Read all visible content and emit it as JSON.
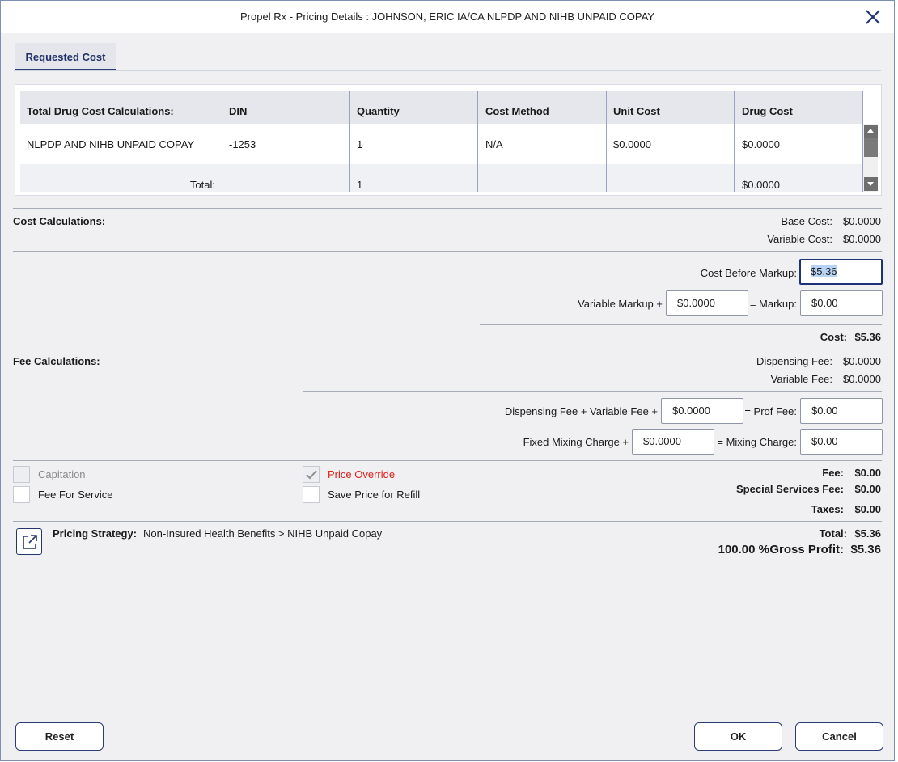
{
  "window": {
    "title": "Propel Rx - Pricing Details :  JOHNSON, ERIC IA/CA  NLPDP AND NIHB UNPAID COPAY"
  },
  "tabs": [
    {
      "label": "Requested Cost",
      "active": true
    }
  ],
  "drug_cost_grid": {
    "columns": [
      "Total Drug Cost Calculations:",
      "DIN",
      "Quantity",
      "Cost Method",
      "Unit Cost",
      "Drug Cost"
    ],
    "rows": [
      {
        "name": "NLPDP AND NIHB UNPAID COPAY",
        "din": "-1253",
        "quantity": "1",
        "cost_method": "N/A",
        "unit_cost": "$0.0000",
        "drug_cost": "$0.0000"
      }
    ],
    "total": {
      "label": "Total:",
      "quantity": "1",
      "drug_cost": "$0.0000"
    }
  },
  "cost_calculations": {
    "section_label": "Cost Calculations:",
    "base_cost_label": "Base Cost:",
    "base_cost_value": "$0.0000",
    "variable_cost_label": "Variable Cost:",
    "variable_cost_value": "$0.0000",
    "cost_before_markup_label": "Cost Before Markup:",
    "cost_before_markup_value": "$5.36",
    "variable_markup_label": "Variable Markup +",
    "variable_markup_value": "$0.0000",
    "markup_label": "= Markup:",
    "markup_value": "$0.00",
    "cost_label": "Cost:",
    "cost_value": "$5.36"
  },
  "fee_calculations": {
    "section_label": "Fee Calculations:",
    "dispensing_fee_label": "Dispensing Fee:",
    "dispensing_fee_value": "$0.0000",
    "variable_fee_label": "Variable Fee:",
    "variable_fee_value": "$0.0000",
    "disp_plus_var_label": "Dispensing Fee + Variable Fee +",
    "disp_plus_var_value": "$0.0000",
    "prof_fee_label": "= Prof Fee:",
    "prof_fee_value": "$0.00",
    "fixed_mixing_label": "Fixed Mixing Charge +",
    "fixed_mixing_value": "$0.0000",
    "mixing_charge_label": "= Mixing Charge:",
    "mixing_charge_value": "$0.00"
  },
  "options": {
    "capitation": {
      "label": "Capitation",
      "checked": false,
      "disabled": true
    },
    "fee_for_service": {
      "label": "Fee For Service",
      "checked": false
    },
    "price_override": {
      "label": "Price Override",
      "checked": true,
      "disabled": true,
      "color": "#e0201b"
    },
    "save_price_for_refill": {
      "label": "Save Price for Refill",
      "checked": false
    }
  },
  "summary": {
    "fee_label": "Fee:",
    "fee_value": "$0.00",
    "special_services_fee_label": "Special Services Fee:",
    "special_services_fee_value": "$0.00",
    "taxes_label": "Taxes:",
    "taxes_value": "$0.00",
    "total_label": "Total:",
    "total_value": "$5.36",
    "gross_profit_percent": "100.00 %",
    "gross_profit_label": "Gross Profit:",
    "gross_profit_value": "$5.36"
  },
  "pricing_strategy": {
    "label": "Pricing Strategy:",
    "value": "Non-Insured Health Benefits > NIHB Unpaid Copay",
    "icon": "external-link-icon"
  },
  "buttons": {
    "reset": "Reset",
    "ok": "OK",
    "cancel": "Cancel"
  },
  "colors": {
    "accent": "#1e3278",
    "tab_underline": "#2b3f78",
    "selection": "#b8d3f5",
    "warning_text": "#e0201b"
  }
}
